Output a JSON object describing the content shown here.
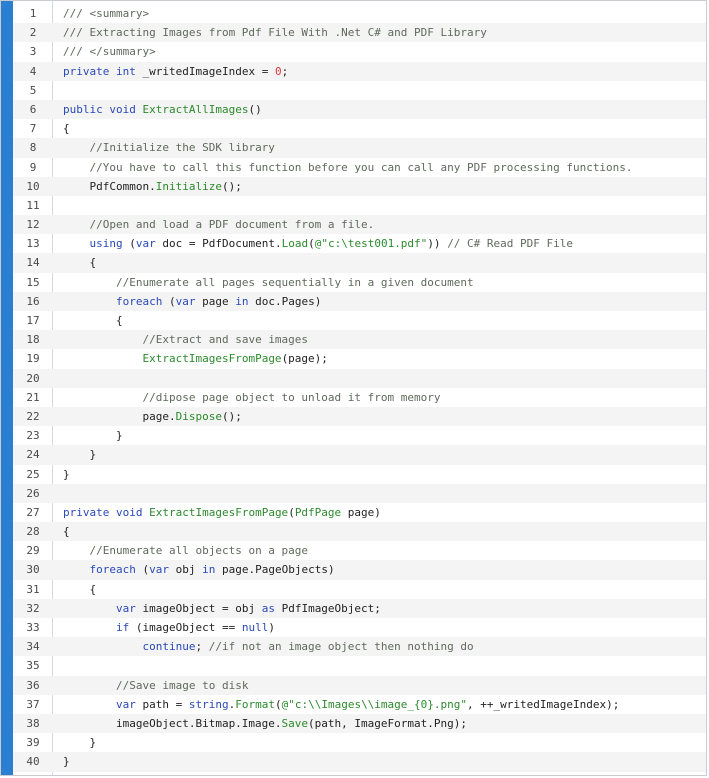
{
  "theme": {
    "accent": "#2b7fd1",
    "stripe": "#f4f4f4",
    "comment": "#5f6a5c",
    "keyword": "#2a49b8",
    "method": "#2c8a2c",
    "string": "#2c8a2c",
    "number": "#e0393e",
    "plain": "#222222"
  },
  "code_lines": [
    {
      "number": "1",
      "tokens": [
        {
          "t": "comment",
          "v": "/// <summary>"
        }
      ]
    },
    {
      "number": "2",
      "tokens": [
        {
          "t": "comment",
          "v": "/// Extracting Images from Pdf File With .Net C# and PDF Library"
        }
      ]
    },
    {
      "number": "3",
      "tokens": [
        {
          "t": "comment",
          "v": "/// </summary>"
        }
      ]
    },
    {
      "number": "4",
      "tokens": [
        {
          "t": "keyword",
          "v": "private"
        },
        {
          "t": "plain",
          "v": " "
        },
        {
          "t": "keyword",
          "v": "int"
        },
        {
          "t": "plain",
          "v": " _writedImageIndex = "
        },
        {
          "t": "number",
          "v": "0"
        },
        {
          "t": "plain",
          "v": ";"
        }
      ]
    },
    {
      "number": "5",
      "tokens": []
    },
    {
      "number": "6",
      "tokens": [
        {
          "t": "keyword",
          "v": "public"
        },
        {
          "t": "plain",
          "v": " "
        },
        {
          "t": "keyword",
          "v": "void"
        },
        {
          "t": "plain",
          "v": " "
        },
        {
          "t": "method",
          "v": "ExtractAllImages"
        },
        {
          "t": "plain",
          "v": "()"
        }
      ]
    },
    {
      "number": "7",
      "tokens": [
        {
          "t": "plain",
          "v": "{"
        }
      ]
    },
    {
      "number": "8",
      "tokens": [
        {
          "t": "plain",
          "v": "    "
        },
        {
          "t": "comment",
          "v": "//Initialize the SDK library"
        }
      ]
    },
    {
      "number": "9",
      "tokens": [
        {
          "t": "plain",
          "v": "    "
        },
        {
          "t": "comment",
          "v": "//You have to call this function before you can call any PDF processing functions."
        }
      ]
    },
    {
      "number": "10",
      "tokens": [
        {
          "t": "plain",
          "v": "    PdfCommon."
        },
        {
          "t": "method",
          "v": "Initialize"
        },
        {
          "t": "plain",
          "v": "();"
        }
      ]
    },
    {
      "number": "11",
      "tokens": []
    },
    {
      "number": "12",
      "tokens": [
        {
          "t": "plain",
          "v": "    "
        },
        {
          "t": "comment",
          "v": "//Open and load a PDF document from a file."
        }
      ]
    },
    {
      "number": "13",
      "tokens": [
        {
          "t": "plain",
          "v": "    "
        },
        {
          "t": "keyword",
          "v": "using"
        },
        {
          "t": "plain",
          "v": " ("
        },
        {
          "t": "keyword",
          "v": "var"
        },
        {
          "t": "plain",
          "v": " doc = PdfDocument."
        },
        {
          "t": "method",
          "v": "Load"
        },
        {
          "t": "plain",
          "v": "("
        },
        {
          "t": "string",
          "v": "@\"c:\\test001.pdf\""
        },
        {
          "t": "plain",
          "v": ")) "
        },
        {
          "t": "comment",
          "v": "// C# Read PDF File"
        }
      ]
    },
    {
      "number": "14",
      "tokens": [
        {
          "t": "plain",
          "v": "    {"
        }
      ]
    },
    {
      "number": "15",
      "tokens": [
        {
          "t": "plain",
          "v": "        "
        },
        {
          "t": "comment",
          "v": "//Enumerate all pages sequentially in a given document"
        }
      ]
    },
    {
      "number": "16",
      "tokens": [
        {
          "t": "plain",
          "v": "        "
        },
        {
          "t": "keyword",
          "v": "foreach"
        },
        {
          "t": "plain",
          "v": " ("
        },
        {
          "t": "keyword",
          "v": "var"
        },
        {
          "t": "plain",
          "v": " page "
        },
        {
          "t": "keyword",
          "v": "in"
        },
        {
          "t": "plain",
          "v": " doc.Pages)"
        }
      ]
    },
    {
      "number": "17",
      "tokens": [
        {
          "t": "plain",
          "v": "        {"
        }
      ]
    },
    {
      "number": "18",
      "tokens": [
        {
          "t": "plain",
          "v": "            "
        },
        {
          "t": "comment",
          "v": "//Extract and save images"
        }
      ]
    },
    {
      "number": "19",
      "tokens": [
        {
          "t": "plain",
          "v": "            "
        },
        {
          "t": "method",
          "v": "ExtractImagesFromPage"
        },
        {
          "t": "plain",
          "v": "(page);"
        }
      ]
    },
    {
      "number": "20",
      "tokens": []
    },
    {
      "number": "21",
      "tokens": [
        {
          "t": "plain",
          "v": "            "
        },
        {
          "t": "comment",
          "v": "//dipose page object to unload it from memory"
        }
      ]
    },
    {
      "number": "22",
      "tokens": [
        {
          "t": "plain",
          "v": "            page."
        },
        {
          "t": "method",
          "v": "Dispose"
        },
        {
          "t": "plain",
          "v": "();"
        }
      ]
    },
    {
      "number": "23",
      "tokens": [
        {
          "t": "plain",
          "v": "        }"
        }
      ]
    },
    {
      "number": "24",
      "tokens": [
        {
          "t": "plain",
          "v": "    }"
        }
      ]
    },
    {
      "number": "25",
      "tokens": [
        {
          "t": "plain",
          "v": "}"
        }
      ]
    },
    {
      "number": "26",
      "tokens": []
    },
    {
      "number": "27",
      "tokens": [
        {
          "t": "keyword",
          "v": "private"
        },
        {
          "t": "plain",
          "v": " "
        },
        {
          "t": "keyword",
          "v": "void"
        },
        {
          "t": "plain",
          "v": " "
        },
        {
          "t": "method",
          "v": "ExtractImagesFromPage"
        },
        {
          "t": "plain",
          "v": "("
        },
        {
          "t": "method",
          "v": "PdfPage"
        },
        {
          "t": "plain",
          "v": " page)"
        }
      ]
    },
    {
      "number": "28",
      "tokens": [
        {
          "t": "plain",
          "v": "{"
        }
      ]
    },
    {
      "number": "29",
      "tokens": [
        {
          "t": "plain",
          "v": "    "
        },
        {
          "t": "comment",
          "v": "//Enumerate all objects on a page"
        }
      ]
    },
    {
      "number": "30",
      "tokens": [
        {
          "t": "plain",
          "v": "    "
        },
        {
          "t": "keyword",
          "v": "foreach"
        },
        {
          "t": "plain",
          "v": " ("
        },
        {
          "t": "keyword",
          "v": "var"
        },
        {
          "t": "plain",
          "v": " obj "
        },
        {
          "t": "keyword",
          "v": "in"
        },
        {
          "t": "plain",
          "v": " page.PageObjects)"
        }
      ]
    },
    {
      "number": "31",
      "tokens": [
        {
          "t": "plain",
          "v": "    {"
        }
      ]
    },
    {
      "number": "32",
      "tokens": [
        {
          "t": "plain",
          "v": "        "
        },
        {
          "t": "keyword",
          "v": "var"
        },
        {
          "t": "plain",
          "v": " imageObject = obj "
        },
        {
          "t": "keyword",
          "v": "as"
        },
        {
          "t": "plain",
          "v": " PdfImageObject;"
        }
      ]
    },
    {
      "number": "33",
      "tokens": [
        {
          "t": "plain",
          "v": "        "
        },
        {
          "t": "keyword",
          "v": "if"
        },
        {
          "t": "plain",
          "v": " (imageObject == "
        },
        {
          "t": "keyword",
          "v": "null"
        },
        {
          "t": "plain",
          "v": ")"
        }
      ]
    },
    {
      "number": "34",
      "tokens": [
        {
          "t": "plain",
          "v": "            "
        },
        {
          "t": "keyword",
          "v": "continue"
        },
        {
          "t": "plain",
          "v": "; "
        },
        {
          "t": "comment",
          "v": "//if not an image object then nothing do"
        }
      ]
    },
    {
      "number": "35",
      "tokens": []
    },
    {
      "number": "36",
      "tokens": [
        {
          "t": "plain",
          "v": "        "
        },
        {
          "t": "comment",
          "v": "//Save image to disk"
        }
      ]
    },
    {
      "number": "37",
      "tokens": [
        {
          "t": "plain",
          "v": "        "
        },
        {
          "t": "keyword",
          "v": "var"
        },
        {
          "t": "plain",
          "v": " path = "
        },
        {
          "t": "keyword",
          "v": "string"
        },
        {
          "t": "plain",
          "v": "."
        },
        {
          "t": "method",
          "v": "Format"
        },
        {
          "t": "plain",
          "v": "("
        },
        {
          "t": "string",
          "v": "@\"c:\\\\Images\\\\image_{0}.png\""
        },
        {
          "t": "plain",
          "v": ", ++_writedImageIndex);"
        }
      ]
    },
    {
      "number": "38",
      "tokens": [
        {
          "t": "plain",
          "v": "        imageObject.Bitmap.Image."
        },
        {
          "t": "method",
          "v": "Save"
        },
        {
          "t": "plain",
          "v": "(path, ImageFormat.Png);"
        }
      ]
    },
    {
      "number": "39",
      "tokens": [
        {
          "t": "plain",
          "v": "    }"
        }
      ]
    },
    {
      "number": "40",
      "tokens": [
        {
          "t": "plain",
          "v": "}"
        }
      ]
    }
  ]
}
